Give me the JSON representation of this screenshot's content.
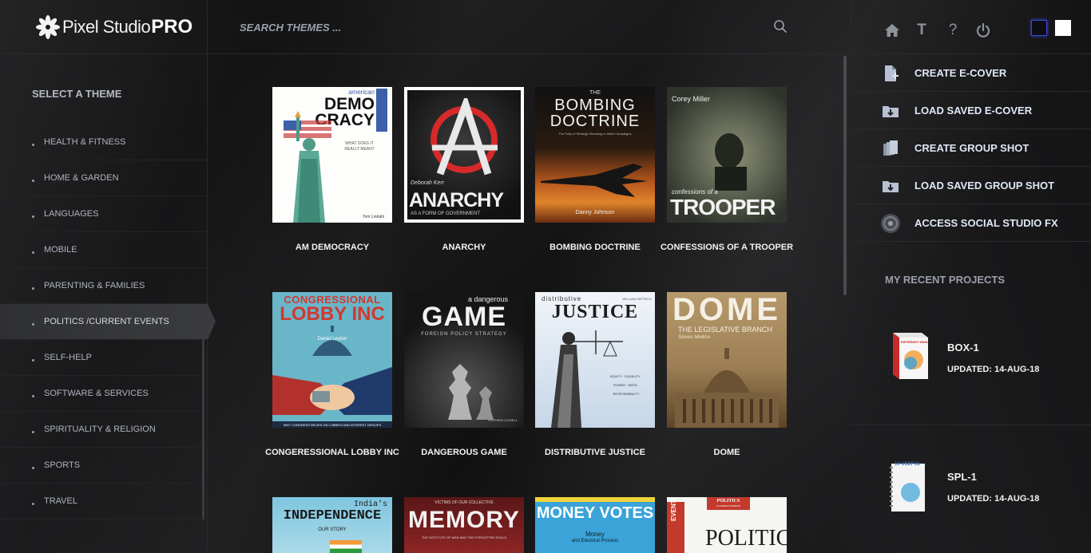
{
  "app": {
    "logo_main": "Pixel Studio",
    "logo_pro": "PRO"
  },
  "search": {
    "placeholder": "SEARCH THEMES ..."
  },
  "header_icons": {
    "text_icon": "T",
    "help_icon": "?"
  },
  "sidebar": {
    "title": "SELECT A THEME",
    "categories": [
      {
        "label": "HEALTH & FITNESS"
      },
      {
        "label": "HOME & GARDEN"
      },
      {
        "label": "LANGUAGES"
      },
      {
        "label": "MOBILE"
      },
      {
        "label": "PARENTING & FAMILIES"
      },
      {
        "label": "POLITICS /CURRENT EVENTS"
      },
      {
        "label": "SELF-HELP"
      },
      {
        "label": "SOFTWARE & SERVICES"
      },
      {
        "label": "SPIRITUALITY & RELIGION"
      },
      {
        "label": "SPORTS"
      },
      {
        "label": "TRAVEL"
      }
    ],
    "active_index": 5
  },
  "themes": [
    {
      "label": "AM DEMOCRACY",
      "cover": {
        "t1": "american",
        "t2": "DEMO",
        "t3": "CRACY",
        "t4": "WHAT DOES IT REALLY MEAN?",
        "t5": "Tom Lindahl"
      }
    },
    {
      "label": "ANARCHY",
      "cover": {
        "t1": "Deborah Kerr",
        "t2": "ANARCHY",
        "t3": "AS A FORM OF GOVERNMENT"
      }
    },
    {
      "label": "BOMBING DOCTRINE",
      "cover": {
        "t1": "THE",
        "t2": "BOMBING",
        "t3": "DOCTRINE",
        "t4": "The Folly of Strategic Bombing in Allied Campaigns",
        "t5": "Danny Johnson"
      }
    },
    {
      "label": "CONFESSIONS OF A TROOPER",
      "cover": {
        "t1": "Corey Miller",
        "t2": "confessions of a",
        "t3": "TROOPER"
      }
    },
    {
      "label": "CONGERESSIONAL LOBBY INC",
      "cover": {
        "t1": "CONGRESSIONAL",
        "t2": "LOBBY INC",
        "t3": "Daniel Leyton",
        "t4": "WHY CONGRESS RELIES ON LOBBIES AND INTEREST GROUPS"
      }
    },
    {
      "label": "DANGEROUS GAME",
      "cover": {
        "t1": "a dangerous",
        "t2": "GAME",
        "t3": "FOREIGN POLICY STRATEGY",
        "t4": "STEPHEN COWELL"
      }
    },
    {
      "label": "DISTRIBUTIVE JUSTICE",
      "cover": {
        "t1": "distributive",
        "t2": "JUSTICE",
        "t3": "WILLIAM DIETRICH",
        "t4": "EQUITY · EQUALITY · POWER · NEED · RESPONSIBILITY"
      }
    },
    {
      "label": "DOME",
      "cover": {
        "t1": "DOME",
        "t2": "THE LEGISLATIVE BRANCH",
        "t3": "Steven Medina"
      }
    },
    {
      "label": "",
      "cover": {
        "t1": "India's",
        "t2": "INDEPENDENCE",
        "t3": "OUR STORY"
      }
    },
    {
      "label": "",
      "cover": {
        "t1": "VICTIMS OF OUR COLLECTIVE",
        "t2": "MEMORY",
        "t3": "THE INSTITUTE OF WAR AND THE FORGOTTEN SOULS"
      }
    },
    {
      "label": "",
      "cover": {
        "t1": "MONEY VOTES",
        "t2": "Money",
        "t3": "and Electoral Process"
      }
    },
    {
      "label": "",
      "cover": {
        "t1": "POLITICS",
        "t2": "& CURRENT EVENTS",
        "t3": "POLITICS",
        "t4": "EVENTS"
      }
    }
  ],
  "actions": [
    {
      "label": "CREATE E-COVER",
      "icon": "file-add-icon"
    },
    {
      "label": "LOAD SAVED E-COVER",
      "icon": "folder-download-icon"
    },
    {
      "label": "CREATE GROUP SHOT",
      "icon": "stack-files-icon"
    },
    {
      "label": "LOAD SAVED GROUP SHOT",
      "icon": "folder-download-icon"
    },
    {
      "label": "ACCESS SOCIAL STUDIO FX",
      "icon": "social-globe-icon"
    }
  ],
  "recent": {
    "title": "MY RECENT PROJECTS",
    "projects": [
      {
        "name": "BOX-1",
        "date": "UPDATED: 14-AUG-18",
        "thumb_text": "DIFFERENT MIND"
      },
      {
        "name": "SPL-1",
        "date": "UPDATED: 14-AUG-18",
        "thumb_text": "10 USEFUL"
      }
    ]
  },
  "colors": {
    "background": "#161616",
    "accent_blue": "#3b4ad0",
    "text_light": "#f2f2f2",
    "text_muted": "#aeb4bd"
  }
}
